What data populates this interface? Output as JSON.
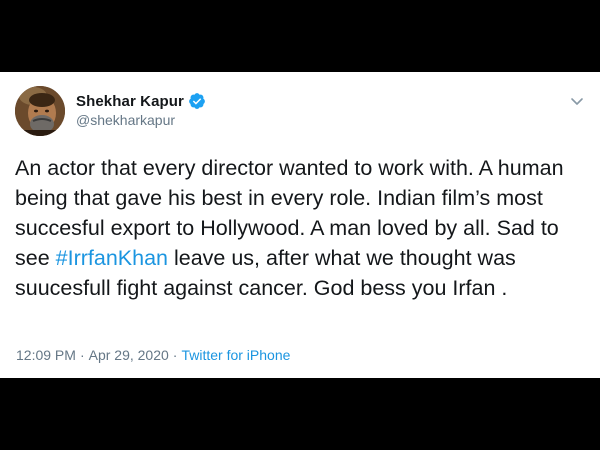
{
  "tweet": {
    "author": {
      "display_name": "Shekhar Kapur",
      "handle": "@shekharkapur",
      "verified": true
    },
    "text_before": "An actor that every director wanted to work with. A human being that gave his best in every role. Indian film’s most succesful export to Hollywood. A man loved by all. Sad to see ",
    "hashtag": "#IrrfanKhan",
    "text_after": " leave us, after what we thought was suucesfull fight against cancer. God bess you Irfan .",
    "time": "12:09 PM",
    "separator": "·",
    "date": "Apr 29, 2020",
    "source": "Twitter for iPhone"
  },
  "colors": {
    "link": "#1b95e0",
    "verified": "#1da1f2",
    "secondary_text": "#657786",
    "primary_text": "#14171a",
    "background": "#000000"
  },
  "icons": {
    "verified": "verified-badge-icon",
    "menu": "chevron-down-icon",
    "avatar": "profile-photo"
  }
}
